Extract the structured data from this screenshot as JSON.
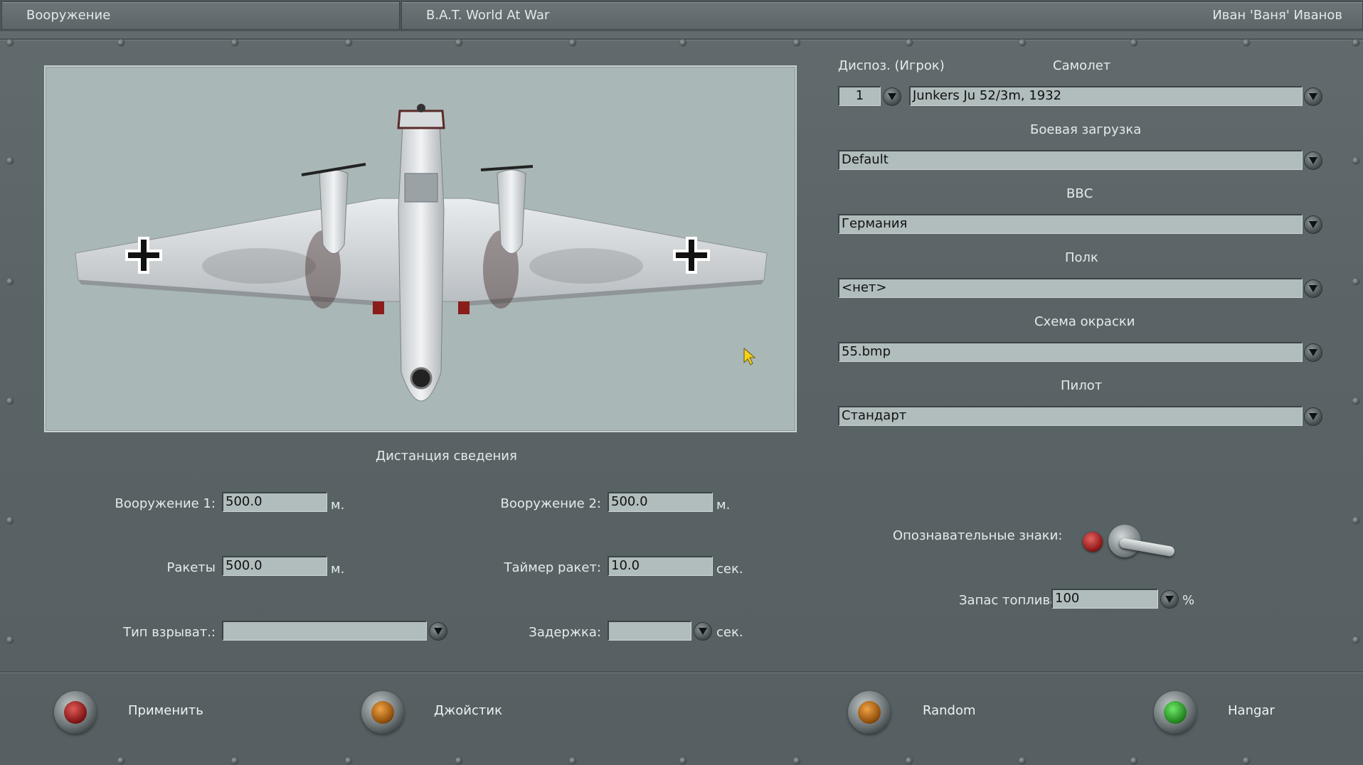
{
  "titlebar": {
    "left": "Вооружение",
    "center": "B.A.T. World At War",
    "right": "Иван 'Ваня' Иванов"
  },
  "aircraft": {
    "slot_label": "Диспоз. (Игрок)",
    "slot_value": "1",
    "plane_label": "Самолет",
    "plane_value": "Junkers Ju 52/3m, 1932",
    "loadout_label": "Боевая загрузка",
    "loadout_value": "Default",
    "airforce_label": "ВВС",
    "airforce_value": "Германия",
    "regiment_label": "Полк",
    "regiment_value": "<нет>",
    "skin_label": "Схема окраски",
    "skin_value": "55.bmp",
    "pilot_label": "Пилот",
    "pilot_value": "Стандарт"
  },
  "markings": {
    "label": "Опознавательные знаки:",
    "enabled": false
  },
  "fuel": {
    "label": "Запас топлива",
    "value": "100",
    "unit": "%"
  },
  "convergence": {
    "title": "Дистанция сведения",
    "weapon1_label": "Вооружение 1:",
    "weapon1_value": "500.0",
    "weapon1_unit": "м.",
    "weapon2_label": "Вооружение 2:",
    "weapon2_value": "500.0",
    "weapon2_unit": "м.",
    "rockets_label": "Ракеты",
    "rockets_value": "500.0",
    "rockets_unit": "м.",
    "rocket_timer_label": "Таймер ракет:",
    "rocket_timer_value": "10.0",
    "rocket_timer_unit": "сек.",
    "fuze_label": "Тип взрыват.:",
    "fuze_value": "",
    "delay_label": "Задержка:",
    "delay_value": "",
    "delay_unit": "сек."
  },
  "buttons": {
    "apply": "Применить",
    "joystick": "Джойстик",
    "random": "Random",
    "hangar": "Hangar"
  },
  "colors": {
    "panel": "#5a6466",
    "viewport_bg": "#a9b7b7",
    "field_bg": "#b1bcbc",
    "lamp_red": "#9e1a18",
    "lamp_orange": "#b8620c",
    "lamp_green": "#2aa526"
  }
}
